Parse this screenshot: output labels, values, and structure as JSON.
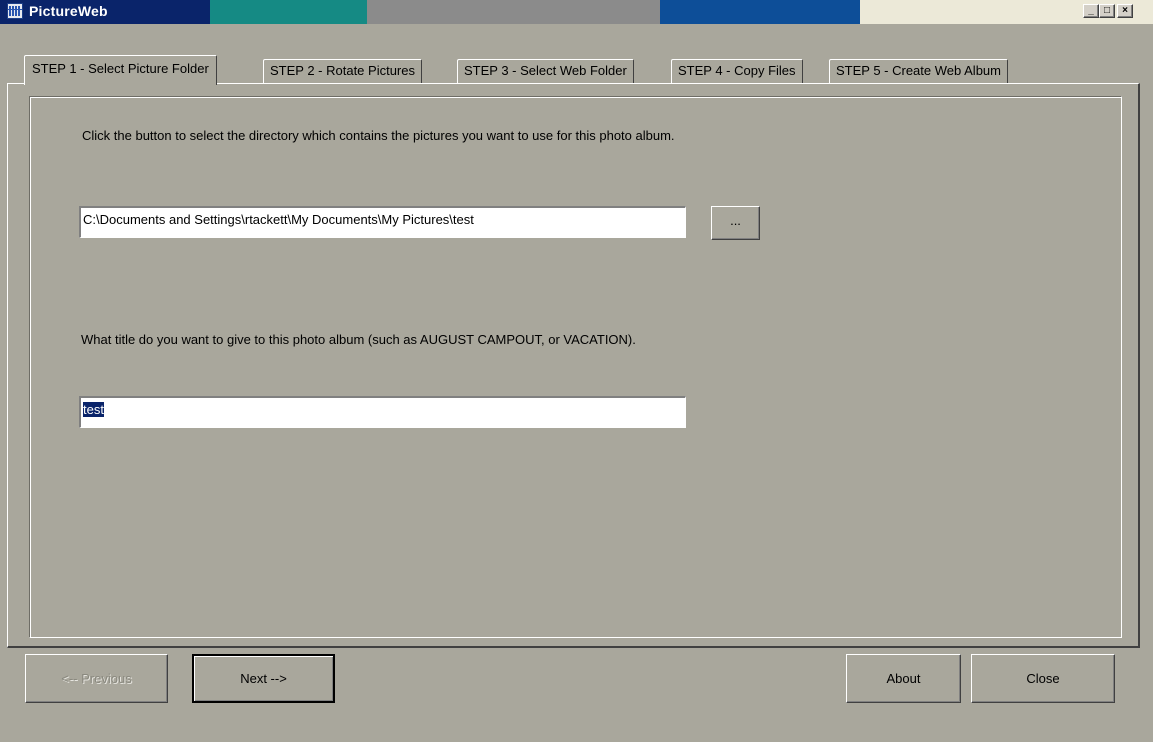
{
  "window": {
    "title": "PictureWeb",
    "controls": {
      "minimize": "_",
      "maximize": "□",
      "close": "×"
    }
  },
  "tabs": [
    {
      "label": "STEP 1 - Select Picture Folder",
      "active": true
    },
    {
      "label": "STEP 2 - Rotate Pictures",
      "active": false
    },
    {
      "label": "STEP 3 - Select Web Folder",
      "active": false
    },
    {
      "label": "STEP 4 - Copy Files",
      "active": false
    },
    {
      "label": "STEP 5 - Create Web Album",
      "active": false
    }
  ],
  "step1": {
    "folder_instructions": "Click the button to select the directory which contains the pictures you want to use for this photo album.",
    "folder_path": "C:\\Documents and Settings\\rtackett\\My Documents\\My Pictures\\test",
    "browse_label": "...",
    "title_instructions": "What title do you want to give to this photo album (such as AUGUST CAMPOUT, or VACATION).",
    "album_title": "test"
  },
  "footer": {
    "previous_label": "<-- Previous",
    "next_label": "Next -->",
    "about_label": "About",
    "close_label": "Close"
  },
  "colors": {
    "title_bar": "#0a246a",
    "face": "#a9a79c",
    "selection": "#0a246a"
  }
}
